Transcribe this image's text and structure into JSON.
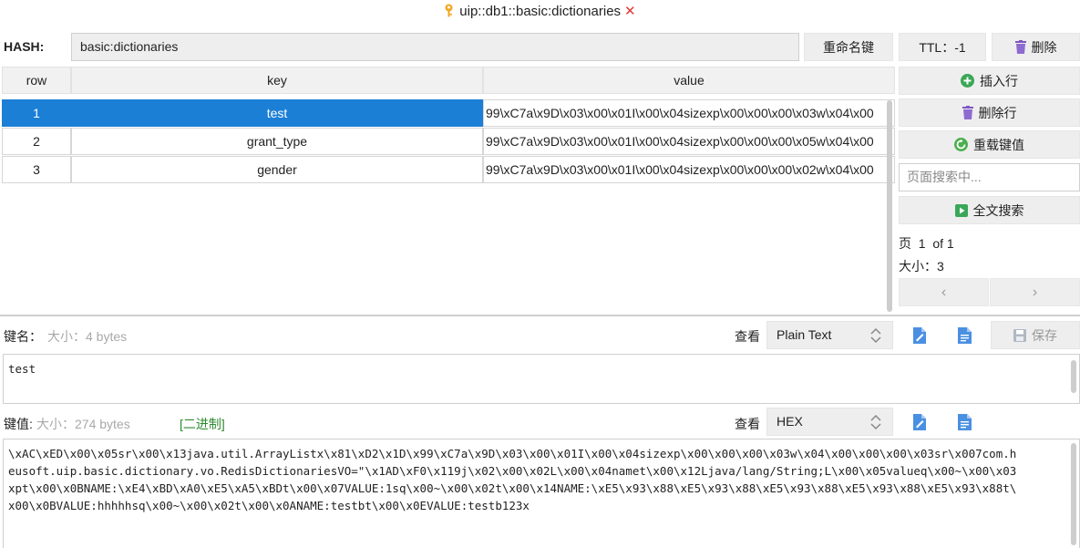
{
  "window": {
    "title": "uip::db1::basic:dictionaries",
    "icon": "key-icon",
    "close_icon": "close-icon"
  },
  "hash": {
    "label": "HASH:",
    "value": "basic:dictionaries",
    "rename_label": "重命名键",
    "ttl_label": "TTL：-1",
    "delete_label": "删除"
  },
  "table": {
    "columns": [
      "row",
      "key",
      "value"
    ],
    "rows": [
      {
        "row": "1",
        "key": "test",
        "value": "99\\xC7a\\x9D\\x03\\x00\\x01I\\x00\\x04sizexp\\x00\\x00\\x00\\x03w\\x04\\x00",
        "selected": true
      },
      {
        "row": "2",
        "key": "grant_type",
        "value": "99\\xC7a\\x9D\\x03\\x00\\x01I\\x00\\x04sizexp\\x00\\x00\\x00\\x05w\\x04\\x00",
        "selected": false
      },
      {
        "row": "3",
        "key": "gender",
        "value": "99\\xC7a\\x9D\\x03\\x00\\x01I\\x00\\x04sizexp\\x00\\x00\\x00\\x02w\\x04\\x00",
        "selected": false
      }
    ]
  },
  "side": {
    "insert_row_label": "插入行",
    "delete_row_label": "删除行",
    "reload_label": "重载键值",
    "search_placeholder": "页面搜索中...",
    "fulltext_label": "全文搜索",
    "page_label": "页  1  of 1",
    "size_label": "大小：3",
    "prev": "‹",
    "next": "›"
  },
  "key_editor": {
    "label": "键名：",
    "size_text": "大小：4 bytes",
    "view_label": "查看",
    "view_mode": "Plain Text",
    "save_label": "保存",
    "content": "test"
  },
  "value_editor": {
    "label": "键值:",
    "size_text": "大小：274 bytes",
    "binary_tag": "[二进制]",
    "view_label": "查看",
    "view_mode": "HEX",
    "lines": [
      "\\xAC\\xED\\x00\\x05sr\\x00\\x13java.util.ArrayListx\\x81\\xD2\\x1D\\x99\\xC7a\\x9D\\x03\\x00\\x01I\\x00\\x04sizexp\\x00\\x00\\x00\\x03w\\x04\\x00\\x00\\x00\\x03sr\\x007com.h",
      "eusoft.uip.basic.dictionary.vo.RedisDictionariesVO=\"\\x1AD\\xF0\\x119j\\x02\\x00\\x02L\\x00\\x04namet\\x00\\x12Ljava/lang/String;L\\x00\\x05valueq\\x00~\\x00\\x03",
      "xpt\\x00\\x0BNAME:\\xE4\\xBD\\xA0\\xE5\\xA5\\xBDt\\x00\\x07VALUE:1sq\\x00~\\x00\\x02t\\x00\\x14NAME:\\xE5\\x93\\x88\\xE5\\x93\\x88\\xE5\\x93\\x88\\xE5\\x93\\x88\\xE5\\x93\\x88t\\",
      "x00\\x0BVALUE:hhhhhsq\\x00~\\x00\\x02t\\x00\\x0ANAME:testbt\\x00\\x0EVALUE:testb123x"
    ]
  },
  "colors": {
    "selection": "#1c7fd6",
    "button_bg": "#eeeeee",
    "accent_green": "#2e8b2e",
    "close_red": "#e53935",
    "key_gold": "#f5a623"
  }
}
